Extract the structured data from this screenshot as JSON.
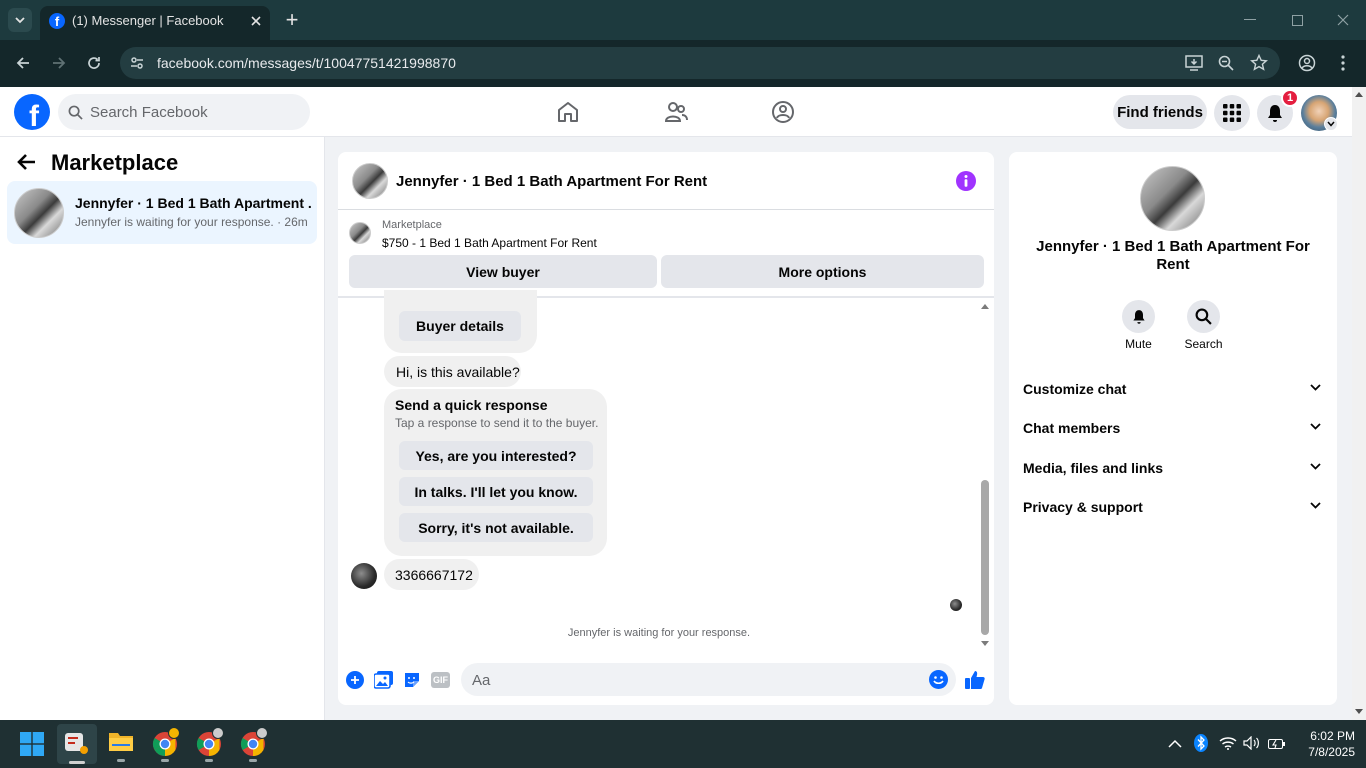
{
  "browser": {
    "tab_title": "(1) Messenger | Facebook",
    "new_tab": "+",
    "url": "facebook.com/messages/t/10047751421998870"
  },
  "header": {
    "search_placeholder": "Search Facebook",
    "find_friends": "Find friends",
    "notifications_count": "1"
  },
  "left_panel": {
    "title": "Marketplace",
    "conversations": [
      {
        "name": "Jennyfer · 1 Bed 1 Bath Apartment ...",
        "preview": "Jennyfer is waiting for your response. · 26m"
      }
    ]
  },
  "chat": {
    "title": "Jennyfer · 1 Bed 1 Bath Apartment For Rent",
    "listing_source": "Marketplace",
    "listing": "$750 - 1 Bed 1 Bath Apartment For Rent",
    "view_buyer": "View buyer",
    "more_options": "More options",
    "messages": {
      "buyer_details": "Buyer details",
      "availability": "Hi, is this available?",
      "quick_title": "Send a quick response",
      "quick_sub": "Tap a response to send it to the buyer.",
      "quick_replies": [
        "Yes, are you interested?",
        "In talks. I'll let you know.",
        "Sorry, it's not available."
      ],
      "phone": "3366667172"
    },
    "waiting": "Jennyfer is waiting for your response.",
    "composer_placeholder": "Aa",
    "gif": "GIF"
  },
  "info_panel": {
    "name": "Jennyfer · 1 Bed 1 Bath Apartment For Rent",
    "mute": "Mute",
    "search": "Search",
    "sections": [
      "Customize chat",
      "Chat members",
      "Media, files and links",
      "Privacy & support"
    ]
  },
  "taskbar": {
    "time": "6:02 PM",
    "date": "7/8/2025"
  },
  "colors": {
    "facebook_blue": "#0866ff",
    "messenger_purple": "#a033ff",
    "notification_red": "#e41e3f"
  }
}
